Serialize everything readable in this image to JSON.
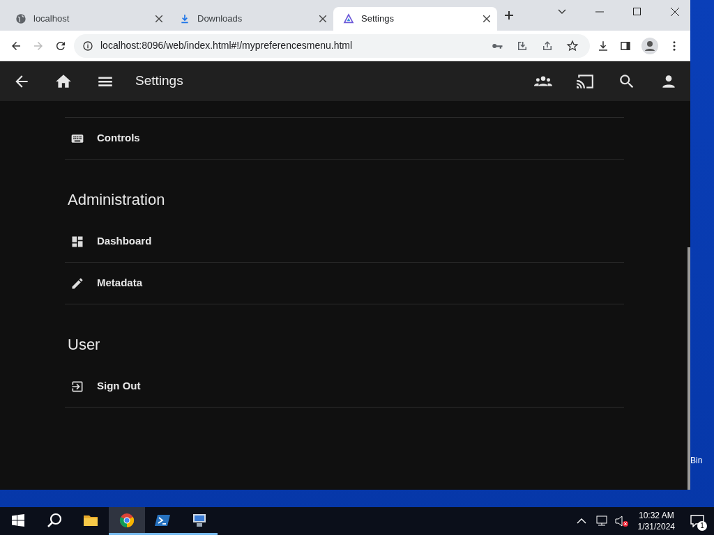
{
  "browser": {
    "tabs": [
      {
        "title": "localhost",
        "selected": false
      },
      {
        "title": "Downloads",
        "selected": false
      },
      {
        "title": "Settings",
        "selected": true
      }
    ],
    "address": "localhost:8096/web/index.html#!/mypreferencesmenu.html"
  },
  "app": {
    "title": "Settings",
    "sections": [
      {
        "items": [
          {
            "label": "Controls"
          }
        ]
      },
      {
        "heading": "Administration",
        "items": [
          {
            "label": "Dashboard"
          },
          {
            "label": "Metadata"
          }
        ]
      },
      {
        "heading": "User",
        "items": [
          {
            "label": "Sign Out"
          }
        ]
      }
    ]
  },
  "desktop": {
    "icon_label": "Bin"
  },
  "taskbar": {
    "apps": [
      {
        "selected": false,
        "running": false
      },
      {
        "selected": true,
        "running": true
      },
      {
        "selected": false,
        "running": true
      },
      {
        "selected": false,
        "running": true
      }
    ],
    "time": "10:32 AM",
    "date": "1/31/2024",
    "notifications": "1"
  }
}
